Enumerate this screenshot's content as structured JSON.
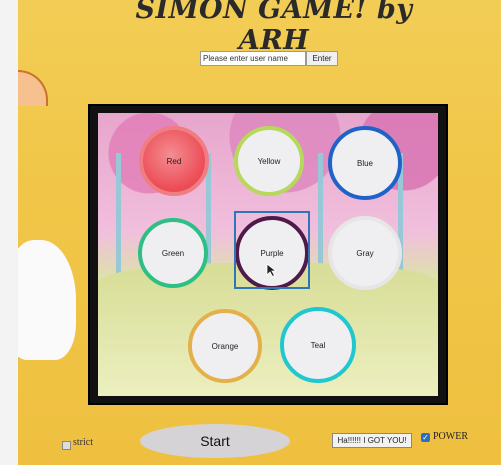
{
  "header": {
    "title": "SIMON GAME! by ARH"
  },
  "user": {
    "placeholder": "Please enter user name",
    "enter_label": "Enter"
  },
  "pads": [
    {
      "label": "Red",
      "border": "#f07d83",
      "fill": "#ec4b55"
    },
    {
      "label": "Yellow",
      "border": "#b6d85b",
      "fill": "#efeff1"
    },
    {
      "label": "Blue",
      "border": "#1f63c8",
      "fill": "#efeff1"
    },
    {
      "label": "Green",
      "border": "#2ebf85",
      "fill": "#efeff1"
    },
    {
      "label": "Purple",
      "border": "#4e1a4a",
      "fill": "#efeff1"
    },
    {
      "label": "Gray",
      "border": "#e6e6e6",
      "fill": "#efeff1"
    },
    {
      "label": "Orange",
      "border": "#e4b04a",
      "fill": "#efeff1"
    },
    {
      "label": "Teal",
      "border": "#21c7cf",
      "fill": "#efeff1"
    }
  ],
  "controls": {
    "strict_label": "strict",
    "start_label": "Start",
    "status_text": "Ha!!!!!! I GOT YOU!",
    "power_label": "POWER",
    "power_checked": true
  }
}
